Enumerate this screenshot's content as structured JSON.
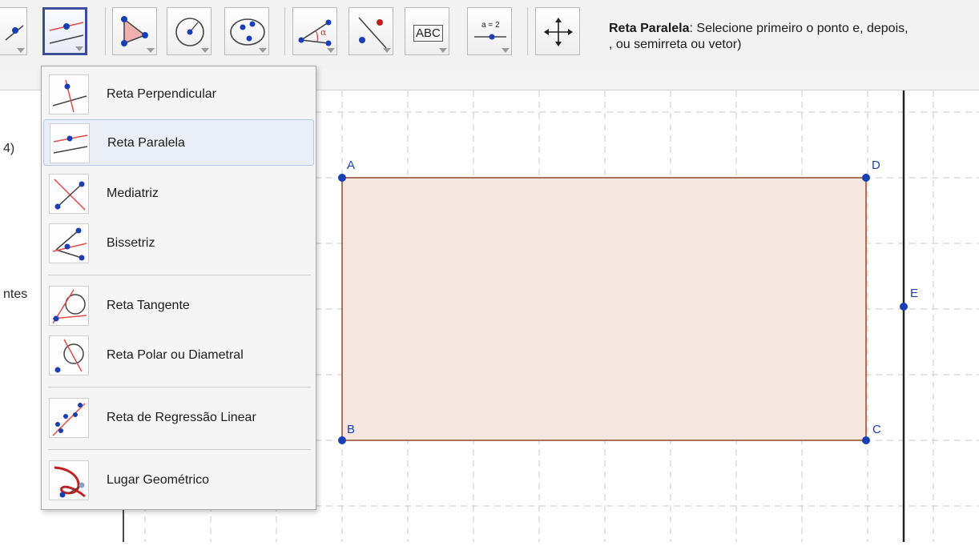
{
  "toolbar": {
    "tools": [
      {
        "name": "point-tool",
        "label": ""
      },
      {
        "name": "parallel-line-tool",
        "label": ""
      },
      {
        "name": "polygon-tool",
        "label": ""
      },
      {
        "name": "circle-tool",
        "label": ""
      },
      {
        "name": "conic-tool",
        "label": ""
      },
      {
        "name": "angle-tool",
        "label": ""
      },
      {
        "name": "reflect-tool",
        "label": ""
      },
      {
        "name": "text-tool",
        "label": "ABC"
      },
      {
        "name": "slider-tool",
        "label": "a = 2"
      },
      {
        "name": "move-view-tool",
        "label": ""
      }
    ],
    "help_title": "Reta Paralela",
    "help_text": ": Selecione primeiro o ponto e, depois,",
    "help_text2": ", ou semirreta ou vetor)"
  },
  "algebra": {
    "fragment1": "4)",
    "fragment2": "ntes"
  },
  "menu": {
    "items": [
      {
        "label": "Reta Perpendicular",
        "icon": "perpendicular-line-icon",
        "highlighted": false
      },
      {
        "label": "Reta Paralela",
        "icon": "parallel-line-icon",
        "highlighted": true
      },
      {
        "label": "Mediatriz",
        "icon": "perpendicular-bisector-icon",
        "highlighted": false
      },
      {
        "label": "Bissetriz",
        "icon": "angle-bisector-icon",
        "highlighted": false
      },
      {
        "label": "Reta Tangente",
        "icon": "tangent-line-icon",
        "highlighted": false
      },
      {
        "label": "Reta Polar ou Diametral",
        "icon": "polar-line-icon",
        "highlighted": false
      },
      {
        "label": "Reta de Regressão Linear",
        "icon": "best-fit-line-icon",
        "highlighted": false
      },
      {
        "label": "Lugar Geométrico",
        "icon": "locus-icon",
        "highlighted": false
      }
    ]
  },
  "graphics": {
    "points": {
      "A": "A",
      "B": "B",
      "C": "C",
      "D": "D",
      "E": "E"
    }
  },
  "colors": {
    "accent": "#3a4d9a",
    "point": "#1a3fb5",
    "line_red": "#e24b4b",
    "polygon_fill": "#f6e6e0",
    "polygon_stroke": "#8a4a2a"
  }
}
